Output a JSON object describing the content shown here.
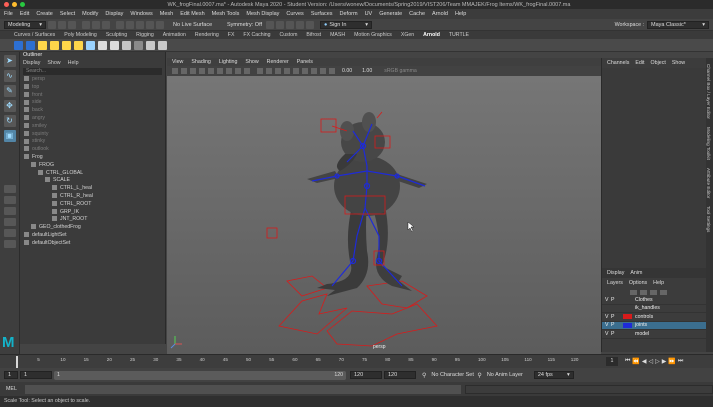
{
  "window": {
    "title": "WK_frogFinal.0007.ma* - Autodesk Maya 2020 - Student Version: /Users/wonew/Documents/Spring2019/VIST206/Team MMAJEK/Frog Items/WK_frogFinal.0007.ma"
  },
  "menubar": [
    "File",
    "Edit",
    "Create",
    "Select",
    "Modify",
    "Display",
    "Windows",
    "Mesh",
    "Edit Mesh",
    "Mesh Tools",
    "Mesh Display",
    "Curves",
    "Surfaces",
    "Deform",
    "UV",
    "Generate",
    "Cache",
    "Arnold",
    "Help"
  ],
  "status": {
    "mode": "Modeling",
    "live_surface": "No Live Surface",
    "symmetry": "Symmetry: Off",
    "sign_in": "Sign In",
    "workspace_label": "Workspace :",
    "workspace_value": "Maya Classic*"
  },
  "shelf_tabs": [
    "Curves / Surfaces",
    "Poly Modeling",
    "Sculpting",
    "Rigging",
    "Animation",
    "Rendering",
    "FX",
    "FX Caching",
    "Custom",
    "Bifrost",
    "MASH",
    "Motion Graphics",
    "XGen",
    "Arnold",
    "TURTLE"
  ],
  "shelf_active": "Arnold",
  "outliner": {
    "title": "Outliner",
    "menu": [
      "Display",
      "Show",
      "Help"
    ],
    "search_placeholder": "Search...",
    "rows": [
      {
        "label": "persp",
        "indent": 0,
        "dim": true
      },
      {
        "label": "top",
        "indent": 0,
        "dim": true
      },
      {
        "label": "front",
        "indent": 0,
        "dim": true
      },
      {
        "label": "side",
        "indent": 0,
        "dim": true
      },
      {
        "label": "back",
        "indent": 0,
        "dim": true
      },
      {
        "label": "angry",
        "indent": 0,
        "dim": true
      },
      {
        "label": "smiley",
        "indent": 0,
        "dim": true
      },
      {
        "label": "squinty",
        "indent": 0,
        "dim": true
      },
      {
        "label": "stinky",
        "indent": 0,
        "dim": true
      },
      {
        "label": "outlook",
        "indent": 0,
        "dim": true
      },
      {
        "label": "Frog",
        "indent": 0,
        "dim": false
      },
      {
        "label": "FROG",
        "indent": 1,
        "dim": false
      },
      {
        "label": "CTRL_GLOBAL",
        "indent": 2,
        "dim": false
      },
      {
        "label": "SCALE",
        "indent": 3,
        "dim": false
      },
      {
        "label": "CTRL_L_heal",
        "indent": 4,
        "dim": false
      },
      {
        "label": "CTRL_R_heal",
        "indent": 4,
        "dim": false
      },
      {
        "label": "CTRL_ROOT",
        "indent": 4,
        "dim": false
      },
      {
        "label": "GRP_IK",
        "indent": 4,
        "dim": false
      },
      {
        "label": "JNT_ROOT",
        "indent": 4,
        "dim": false
      },
      {
        "label": "GEO_clothedFrog",
        "indent": 1,
        "dim": false
      },
      {
        "label": "defaultLightSet",
        "indent": 0,
        "dim": false
      },
      {
        "label": "defaultObjectSet",
        "indent": 0,
        "dim": false
      }
    ]
  },
  "viewport": {
    "menu": [
      "View",
      "Shading",
      "Lighting",
      "Show",
      "Renderer",
      "Panels"
    ],
    "exposure": "0.00",
    "gamma": "1.00",
    "colorspace": "sRGB gamma",
    "camera_label": "persp"
  },
  "channel_box": {
    "menu": [
      "Channels",
      "Edit",
      "Object",
      "Show"
    ]
  },
  "layer_editor": {
    "tabs": [
      "Display",
      "Anim"
    ],
    "menu": [
      "Layers",
      "Options",
      "Help"
    ],
    "layers": [
      {
        "v": "V",
        "p": "P",
        "name": "Clothes",
        "color": "#3c3c3c",
        "selected": false
      },
      {
        "v": "",
        "p": "",
        "name": "ik_handles",
        "color": "#3c3c3c",
        "selected": false
      },
      {
        "v": "V",
        "p": "P",
        "name": "controls",
        "color": "#d81b1b",
        "selected": false
      },
      {
        "v": "V",
        "p": "P",
        "name": "joints",
        "color": "#1e2bd8",
        "selected": true
      },
      {
        "v": "V",
        "p": "P",
        "name": "model",
        "color": "#3c3c3c",
        "selected": false
      }
    ]
  },
  "side_tabs": [
    "Channel Box / Layer Editor",
    "Modeling Toolkit",
    "Attribute Editor",
    "Tool Settings"
  ],
  "timeline": {
    "ticks": [
      "5",
      "10",
      "15",
      "20",
      "25",
      "30",
      "35",
      "40",
      "45",
      "50",
      "55",
      "60",
      "65",
      "70",
      "75",
      "80",
      "85",
      "90",
      "95",
      "100",
      "105",
      "110",
      "115",
      "120"
    ],
    "current_frame": "1"
  },
  "range": {
    "start": "1",
    "anim_start": "1",
    "playback_start": "1",
    "playback_end": "120",
    "anim_end": "120",
    "end": "120",
    "character_set": "No Character Set",
    "anim_layer": "No Anim Layer",
    "fps": "24 fps"
  },
  "cmdline": {
    "lang": "MEL"
  },
  "helpline": "Scale Tool: Select an object to scale.",
  "colors": {
    "accent": "#5285a6",
    "selection_blue": "#3b6e8f",
    "control_red": "#d81b1b",
    "joint_blue": "#1e2bd8"
  }
}
